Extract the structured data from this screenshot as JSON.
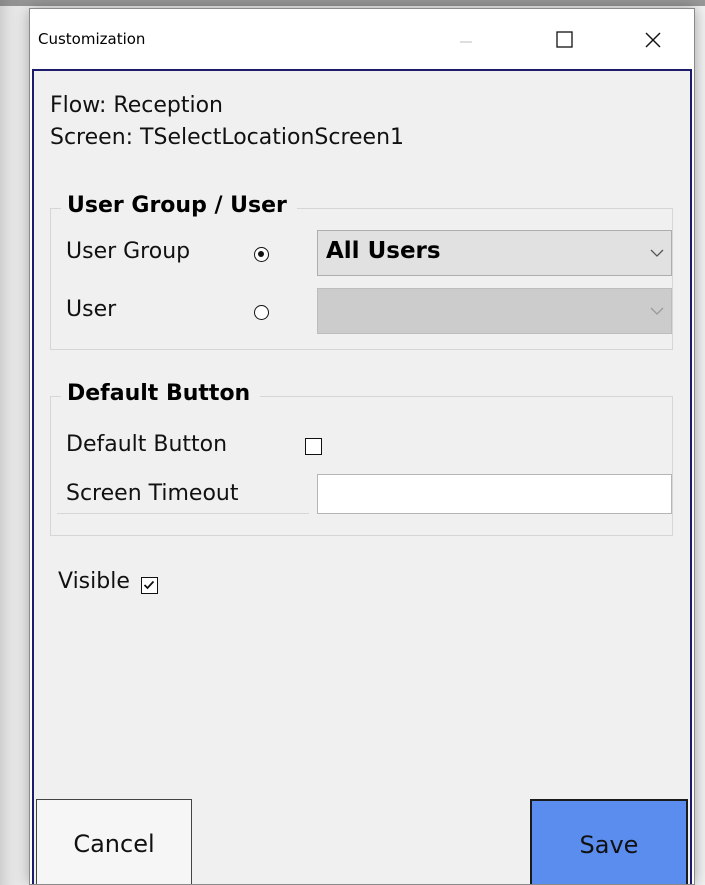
{
  "window": {
    "title": "Customization",
    "controls": [
      "minimize-icon",
      "maximize-icon",
      "close-icon"
    ]
  },
  "info": {
    "flow": "Flow: Reception",
    "screen": "Screen: TSelectLocationScreen1"
  },
  "user_group_section": {
    "legend": "User Group / User",
    "user_group_label": "User Group",
    "user_group_selected": true,
    "user_group_value": "All Users",
    "user_label": "User",
    "user_selected": false,
    "user_value": ""
  },
  "default_button_section": {
    "legend": "Default Button",
    "default_button_label": "Default Button",
    "default_button_checked": false,
    "screen_timeout_label": "Screen Timeout",
    "screen_timeout_value": ""
  },
  "visible": {
    "label": "Visible",
    "checked": true
  },
  "buttons": {
    "cancel": "Cancel",
    "save": "Save"
  },
  "colors": {
    "save_button": "#5b8def",
    "client_border": "#1c1c6b",
    "client_background": "#f0f0f0"
  }
}
